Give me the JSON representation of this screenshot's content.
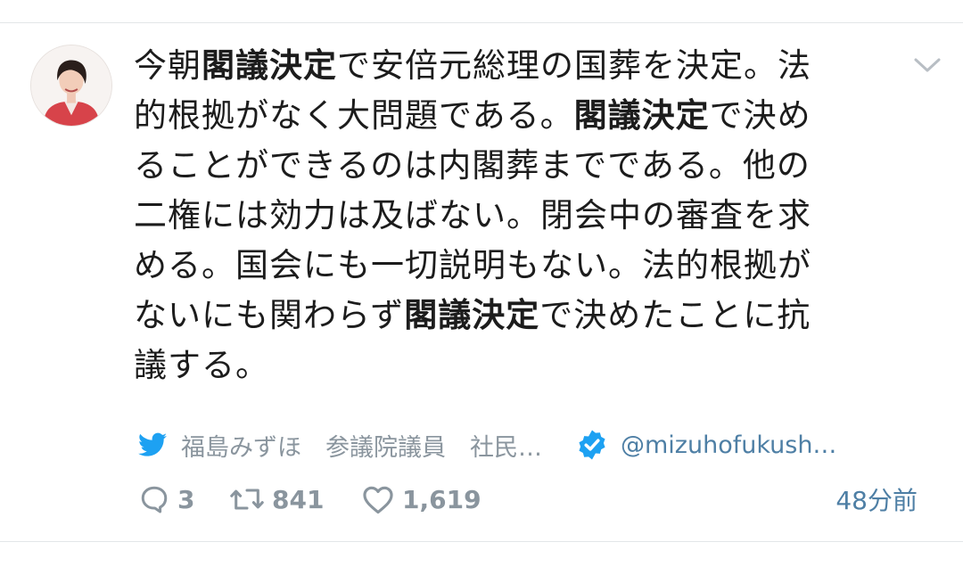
{
  "tweet": {
    "lines": [
      [
        {
          "t": "今朝",
          "b": false
        },
        {
          "t": "閣議決定",
          "b": true
        },
        {
          "t": "で安倍元総理の国葬を決定。法",
          "b": false
        }
      ],
      [
        {
          "t": "的根拠がなく大問題である。",
          "b": false
        },
        {
          "t": "閣議決定",
          "b": true
        },
        {
          "t": "で決め",
          "b": false
        }
      ],
      [
        {
          "t": "ることができるのは内閣葬までである。他の",
          "b": false
        }
      ],
      [
        {
          "t": "二権には効力は及ばない。閉会中の審査を求",
          "b": false
        }
      ],
      [
        {
          "t": "める。国会にも一切説明もない。法的根拠が",
          "b": false
        }
      ],
      [
        {
          "t": "ないにも関わらず",
          "b": false
        },
        {
          "t": "閣議決定",
          "b": true
        },
        {
          "t": "で決めたことに抗",
          "b": false
        }
      ],
      [
        {
          "t": "議する。",
          "b": false
        }
      ]
    ]
  },
  "meta": {
    "name": "福島みずほ　参議院議員　社民…",
    "handle": "@mizuhofukush…"
  },
  "actions": {
    "replies": "3",
    "retweets": "841",
    "likes": "1,619",
    "time": "48分前"
  },
  "icons": {
    "bird": "twitter-bird-icon",
    "verified": "verified-badge-icon",
    "reply": "reply-icon",
    "retweet": "retweet-icon",
    "like": "heart-icon",
    "menu": "chevron-down-icon"
  },
  "colors": {
    "twitter_blue": "#1da1f2",
    "link_blue": "#4e7fa5",
    "muted_gray": "#8a959e"
  }
}
